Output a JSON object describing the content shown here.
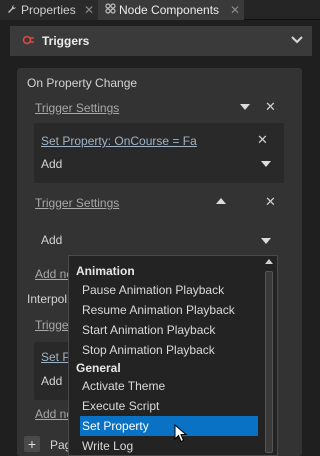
{
  "tabs": [
    {
      "label": "Properties",
      "icon": "wrench-icon"
    },
    {
      "label": "Node Components",
      "icon": "components-icon"
    }
  ],
  "section": {
    "title": "Triggers"
  },
  "panel": {
    "title": "On Property Change",
    "trigger_settings_1": "Trigger Settings",
    "set_property_link": "Set Property: OnCourse = Fa",
    "add_1": "Add",
    "trigger_settings_2": "Trigger Settings",
    "add_2": "Add",
    "add_new_1": "Add ne",
    "interpol": "Interpol",
    "trigger_3": "Trigge",
    "set_p": "Set P",
    "add_3": "Add",
    "add_new_2": "Add ne",
    "page_label": "Pag"
  },
  "dropdown": {
    "groups": [
      {
        "name": "Animation",
        "items": [
          "Pause Animation Playback",
          "Resume Animation Playback",
          "Start Animation Playback",
          "Stop Animation Playback"
        ]
      },
      {
        "name": "General",
        "items": [
          "Activate Theme",
          "Execute Script",
          "Set Property",
          "Write Log"
        ]
      }
    ],
    "selected": "Set Property"
  },
  "colors": {
    "selection": "#0a72c4",
    "background": "#1f1f1f",
    "panel": "#333333"
  }
}
